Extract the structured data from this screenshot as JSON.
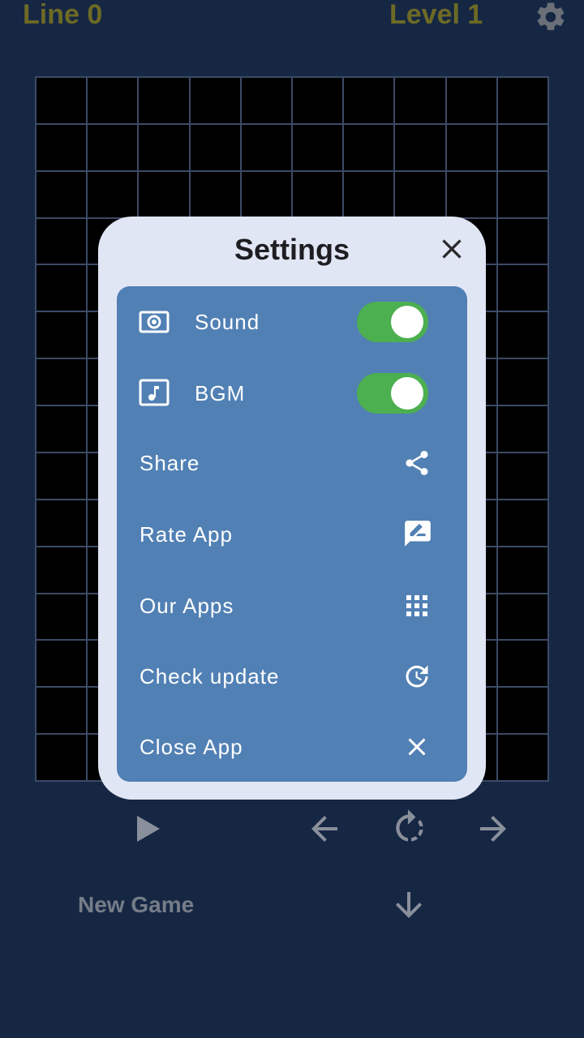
{
  "hud": {
    "line_label": "Line 0",
    "level_label": "Level 1"
  },
  "board": {
    "columns": 10,
    "rows": 15
  },
  "controls": {
    "new_game_label": "New Game"
  },
  "settings_dialog": {
    "title": "Settings",
    "items": [
      {
        "label": "Sound",
        "icon": "speaker-icon",
        "type": "toggle",
        "enabled": true
      },
      {
        "label": "BGM",
        "icon": "music-note-icon",
        "type": "toggle",
        "enabled": true
      },
      {
        "label": "Share",
        "icon": "share-icon",
        "type": "action"
      },
      {
        "label": "Rate App",
        "icon": "rate-review-icon",
        "type": "action"
      },
      {
        "label": "Our Apps",
        "icon": "apps-grid-icon",
        "type": "action"
      },
      {
        "label": "Check update",
        "icon": "update-icon",
        "type": "action"
      },
      {
        "label": "Close App",
        "icon": "close-icon",
        "type": "action"
      }
    ]
  },
  "colors": {
    "background": "#162744",
    "hud_text": "#6d6a25",
    "dialog_bg": "#e1e6f5",
    "panel_bg": "#5180b4",
    "toggle_on": "#4caf50",
    "control_icon": "#8a909b"
  }
}
